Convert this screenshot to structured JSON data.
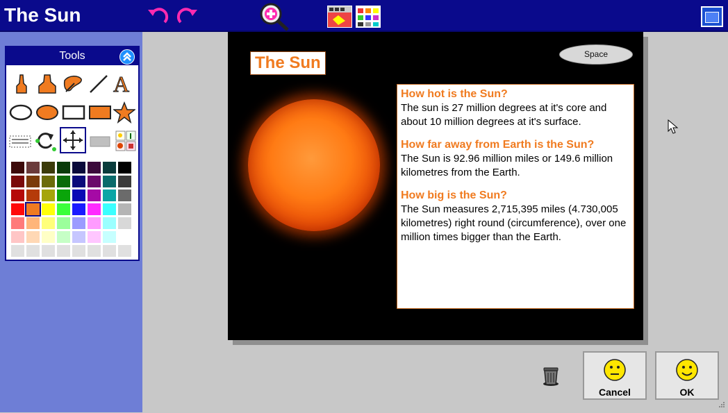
{
  "app": {
    "title": "The Sun"
  },
  "toolbar": {
    "undo_icon": "undo-icon",
    "redo_icon": "redo-icon",
    "zoom_icon": "zoom-in-icon",
    "picture_icon": "picture-icon",
    "palette_icon": "palette-icon",
    "window_icon": "window-icon"
  },
  "tools": {
    "header": "Tools",
    "items": [
      "highlighter-pen",
      "marker-pen",
      "eraser",
      "line",
      "text",
      "ellipse",
      "filled-ellipse",
      "rectangle",
      "filled-rectangle",
      "star",
      "select",
      "rotate",
      "move",
      "fill",
      "stamps"
    ]
  },
  "palette": {
    "colors": [
      [
        "#3d0a0a",
        "#6b3b3b",
        "#3b3b0a",
        "#0a3b0a",
        "#0a0a3b",
        "#3b0a3b",
        "#0a3b3b",
        "#000000"
      ],
      [
        "#7a0a0a",
        "#7a3b0a",
        "#6b6b0a",
        "#0a6b0a",
        "#0a0a7a",
        "#6b0a6b",
        "#0a6b6b",
        "#3b3b3b"
      ],
      [
        "#b50a0a",
        "#b53b0a",
        "#a5a50a",
        "#0aa50a",
        "#0a0ab5",
        "#a50aa5",
        "#0aa5a5",
        "#6b6b6b"
      ],
      [
        "#ff0a0a",
        "#f07b20",
        "#ffff0a",
        "#3bff3b",
        "#1a1aff",
        "#ff2bff",
        "#3bffff",
        "#b5b5b5"
      ],
      [
        "#ff7a7a",
        "#ffb57a",
        "#ffff7a",
        "#9bff9b",
        "#9b9bff",
        "#ff9bff",
        "#9bffff",
        "#d8d8d8"
      ],
      [
        "#ffc6c6",
        "#ffd8b5",
        "#ffffc6",
        "#c6ffc6",
        "#c6c6ff",
        "#ffc6ff",
        "#c6ffff",
        "#ffffff"
      ],
      [
        "#e0e0e0",
        "#e0e0e0",
        "#e0e0e0",
        "#e0e0e0",
        "#e0e0e0",
        "#e0e0e0",
        "#e0e0e0",
        "#e0e0e0"
      ]
    ],
    "selected": "#f07b20"
  },
  "canvas": {
    "title": "The Sun",
    "space_label": "Space",
    "q1": "How hot is the Sun?",
    "a1": "The sun is 27 million degrees at it's core and about 10 million degrees at it's surface.",
    "q2": "How far away from Earth is the Sun?",
    "a2": "The Sun is 92.96 million miles or 149.6 million kilometres from the Earth.",
    "q3": "How big is the Sun?",
    "a3": "The Sun measures 2,715,395 miles (4.730,005 kilometres) right round (circumference), over one million times bigger than the Earth."
  },
  "buttons": {
    "cancel": "Cancel",
    "ok": "OK"
  },
  "colors": {
    "titlebar": "#0a0a8c",
    "sidebar": "#6e7ed6",
    "accent": "#f07b20"
  }
}
